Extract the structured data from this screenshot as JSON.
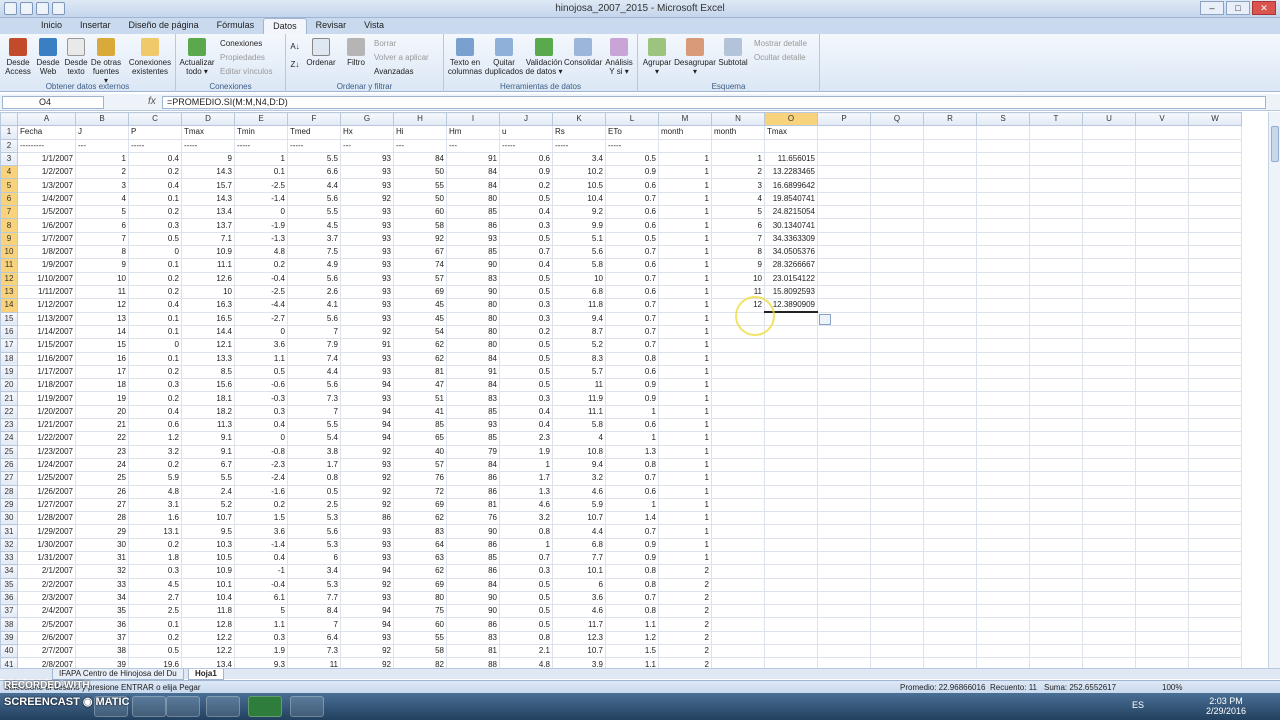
{
  "window": {
    "title": "hinojosa_2007_2015 - Microsoft Excel"
  },
  "tabs": [
    "Inicio",
    "Insertar",
    "Diseño de página",
    "Fórmulas",
    "Datos",
    "Revisar",
    "Vista"
  ],
  "active_tab": "Datos",
  "ribbon": {
    "groups": [
      {
        "label": "Obtener datos externos",
        "buttons": [
          "Desde Access",
          "Desde Web",
          "Desde texto",
          "De otras fuentes ▾",
          "Conexiones existentes"
        ]
      },
      {
        "label": "Conexiones",
        "buttons": [
          "Actualizar todo ▾"
        ],
        "small": [
          "Conexiones",
          "Propiedades",
          "Editar vínculos"
        ]
      },
      {
        "label": "Ordenar y filtrar",
        "buttons": [
          "Ordenar",
          "Filtro"
        ],
        "small": [
          "Borrar",
          "Volver a aplicar",
          "Avanzadas"
        ]
      },
      {
        "label": "Herramientas de datos",
        "buttons": [
          "Texto en columnas",
          "Quitar duplicados",
          "Validación de datos ▾",
          "Consolidar",
          "Análisis Y si ▾"
        ]
      },
      {
        "label": "Esquema",
        "buttons": [
          "Agrupar ▾",
          "Desagrupar ▾",
          "Subtotal"
        ],
        "small": [
          "Mostrar detalle",
          "Ocultar detalle"
        ]
      }
    ]
  },
  "formula_bar": {
    "name_box": "O4",
    "fx": "fx",
    "formula": "=PROMEDIO.SI(M:M,N4,D:D)"
  },
  "columns": [
    "A",
    "B",
    "C",
    "D",
    "E",
    "F",
    "G",
    "H",
    "I",
    "J",
    "K",
    "L",
    "M",
    "N",
    "O",
    "P",
    "Q",
    "R",
    "S",
    "T",
    "U",
    "V",
    "W"
  ],
  "selected_column": "O",
  "selected_rows": [
    4,
    5,
    6,
    7,
    8,
    9,
    10,
    11,
    12,
    13,
    14
  ],
  "rows": [
    {
      "n": "1",
      "c": [
        "Fecha",
        "J",
        "P",
        "Tmax",
        "Tmin",
        "Tmed",
        "Hx",
        "Hi",
        "Hm",
        "u",
        "Rs",
        "ETo",
        "month",
        "month",
        "Tmax"
      ]
    },
    {
      "n": "2",
      "c": [
        "---------",
        "---",
        "-----",
        "-----",
        "-----",
        "-----",
        "---",
        "---",
        "---",
        "-----",
        "-----",
        "-----",
        "",
        "",
        ""
      ]
    },
    {
      "n": "3",
      "c": [
        "1/1/2007",
        "1",
        "0.4",
        "9",
        "1",
        "5.5",
        "93",
        "84",
        "91",
        "0.6",
        "3.4",
        "0.5",
        "1",
        "1",
        "11.656015"
      ]
    },
    {
      "n": "4",
      "c": [
        "1/2/2007",
        "2",
        "0.2",
        "14.3",
        "0.1",
        "6.6",
        "93",
        "50",
        "84",
        "0.9",
        "10.2",
        "0.9",
        "1",
        "2",
        "13.2283465"
      ]
    },
    {
      "n": "5",
      "c": [
        "1/3/2007",
        "3",
        "0.4",
        "15.7",
        "-2.5",
        "4.4",
        "93",
        "55",
        "84",
        "0.2",
        "10.5",
        "0.6",
        "1",
        "3",
        "16.6899642"
      ]
    },
    {
      "n": "6",
      "c": [
        "1/4/2007",
        "4",
        "0.1",
        "14.3",
        "-1.4",
        "5.6",
        "92",
        "50",
        "80",
        "0.5",
        "10.4",
        "0.7",
        "1",
        "4",
        "19.8540741"
      ]
    },
    {
      "n": "7",
      "c": [
        "1/5/2007",
        "5",
        "0.2",
        "13.4",
        "0",
        "5.5",
        "93",
        "60",
        "85",
        "0.4",
        "9.2",
        "0.6",
        "1",
        "5",
        "24.8215054"
      ]
    },
    {
      "n": "8",
      "c": [
        "1/6/2007",
        "6",
        "0.3",
        "13.7",
        "-1.9",
        "4.5",
        "93",
        "58",
        "86",
        "0.3",
        "9.9",
        "0.6",
        "1",
        "6",
        "30.1340741"
      ]
    },
    {
      "n": "9",
      "c": [
        "1/7/2007",
        "7",
        "0.5",
        "7.1",
        "-1.3",
        "3.7",
        "93",
        "92",
        "93",
        "0.5",
        "5.1",
        "0.5",
        "1",
        "7",
        "34.3363309"
      ]
    },
    {
      "n": "10",
      "c": [
        "1/8/2007",
        "8",
        "0",
        "10.9",
        "4.8",
        "7.5",
        "93",
        "67",
        "85",
        "0.7",
        "5.6",
        "0.7",
        "1",
        "8",
        "34.0505376"
      ]
    },
    {
      "n": "11",
      "c": [
        "1/9/2007",
        "9",
        "0.1",
        "11.1",
        "0.2",
        "4.9",
        "93",
        "74",
        "90",
        "0.4",
        "5.8",
        "0.6",
        "1",
        "9",
        "28.3266667"
      ]
    },
    {
      "n": "12",
      "c": [
        "1/10/2007",
        "10",
        "0.2",
        "12.6",
        "-0.4",
        "5.6",
        "93",
        "57",
        "83",
        "0.5",
        "10",
        "0.7",
        "1",
        "10",
        "23.0154122"
      ]
    },
    {
      "n": "13",
      "c": [
        "1/11/2007",
        "11",
        "0.2",
        "10",
        "-2.5",
        "2.6",
        "93",
        "69",
        "90",
        "0.5",
        "6.8",
        "0.6",
        "1",
        "11",
        "15.8092593"
      ]
    },
    {
      "n": "14",
      "c": [
        "1/12/2007",
        "12",
        "0.4",
        "16.3",
        "-4.4",
        "4.1",
        "93",
        "45",
        "80",
        "0.3",
        "11.8",
        "0.7",
        "1",
        "12",
        "12.3890909"
      ]
    },
    {
      "n": "15",
      "c": [
        "1/13/2007",
        "13",
        "0.1",
        "16.5",
        "-2.7",
        "5.6",
        "93",
        "45",
        "80",
        "0.3",
        "9.4",
        "0.7",
        "1",
        "",
        ""
      ]
    },
    {
      "n": "16",
      "c": [
        "1/14/2007",
        "14",
        "0.1",
        "14.4",
        "0",
        "7",
        "92",
        "54",
        "80",
        "0.2",
        "8.7",
        "0.7",
        "1",
        "",
        ""
      ]
    },
    {
      "n": "17",
      "c": [
        "1/15/2007",
        "15",
        "0",
        "12.1",
        "3.6",
        "7.9",
        "91",
        "62",
        "80",
        "0.5",
        "5.2",
        "0.7",
        "1",
        "",
        ""
      ]
    },
    {
      "n": "18",
      "c": [
        "1/16/2007",
        "16",
        "0.1",
        "13.3",
        "1.1",
        "7.4",
        "93",
        "62",
        "84",
        "0.5",
        "8.3",
        "0.8",
        "1",
        "",
        ""
      ]
    },
    {
      "n": "19",
      "c": [
        "1/17/2007",
        "17",
        "0.2",
        "8.5",
        "0.5",
        "4.4",
        "93",
        "81",
        "91",
        "0.5",
        "5.7",
        "0.6",
        "1",
        "",
        ""
      ]
    },
    {
      "n": "20",
      "c": [
        "1/18/2007",
        "18",
        "0.3",
        "15.6",
        "-0.6",
        "5.6",
        "94",
        "47",
        "84",
        "0.5",
        "11",
        "0.9",
        "1",
        "",
        ""
      ]
    },
    {
      "n": "21",
      "c": [
        "1/19/2007",
        "19",
        "0.2",
        "18.1",
        "-0.3",
        "7.3",
        "93",
        "51",
        "83",
        "0.3",
        "11.9",
        "0.9",
        "1",
        "",
        ""
      ]
    },
    {
      "n": "22",
      "c": [
        "1/20/2007",
        "20",
        "0.4",
        "18.2",
        "0.3",
        "7",
        "94",
        "41",
        "85",
        "0.4",
        "11.1",
        "1",
        "1",
        "",
        ""
      ]
    },
    {
      "n": "23",
      "c": [
        "1/21/2007",
        "21",
        "0.6",
        "11.3",
        "0.4",
        "5.5",
        "94",
        "85",
        "93",
        "0.4",
        "5.8",
        "0.6",
        "1",
        "",
        ""
      ]
    },
    {
      "n": "24",
      "c": [
        "1/22/2007",
        "22",
        "1.2",
        "9.1",
        "0",
        "5.4",
        "94",
        "65",
        "85",
        "2.3",
        "4",
        "1",
        "1",
        "",
        ""
      ]
    },
    {
      "n": "25",
      "c": [
        "1/23/2007",
        "23",
        "3.2",
        "9.1",
        "-0.8",
        "3.8",
        "92",
        "40",
        "79",
        "1.9",
        "10.8",
        "1.3",
        "1",
        "",
        ""
      ]
    },
    {
      "n": "26",
      "c": [
        "1/24/2007",
        "24",
        "0.2",
        "6.7",
        "-2.3",
        "1.7",
        "93",
        "57",
        "84",
        "1",
        "9.4",
        "0.8",
        "1",
        "",
        ""
      ]
    },
    {
      "n": "27",
      "c": [
        "1/25/2007",
        "25",
        "5.9",
        "5.5",
        "-2.4",
        "0.8",
        "92",
        "76",
        "86",
        "1.7",
        "3.2",
        "0.7",
        "1",
        "",
        ""
      ]
    },
    {
      "n": "28",
      "c": [
        "1/26/2007",
        "26",
        "4.8",
        "2.4",
        "-1.6",
        "0.5",
        "92",
        "72",
        "86",
        "1.3",
        "4.6",
        "0.6",
        "1",
        "",
        ""
      ]
    },
    {
      "n": "29",
      "c": [
        "1/27/2007",
        "27",
        "3.1",
        "5.2",
        "0.2",
        "2.5",
        "92",
        "69",
        "81",
        "4.6",
        "5.9",
        "1",
        "1",
        "",
        ""
      ]
    },
    {
      "n": "30",
      "c": [
        "1/28/2007",
        "28",
        "1.6",
        "10.7",
        "1.5",
        "5.3",
        "86",
        "62",
        "76",
        "3.2",
        "10.7",
        "1.4",
        "1",
        "",
        ""
      ]
    },
    {
      "n": "31",
      "c": [
        "1/29/2007",
        "29",
        "13.1",
        "9.5",
        "3.6",
        "5.6",
        "93",
        "83",
        "90",
        "0.8",
        "4.4",
        "0.7",
        "1",
        "",
        ""
      ]
    },
    {
      "n": "32",
      "c": [
        "1/30/2007",
        "30",
        "0.2",
        "10.3",
        "-1.4",
        "5.3",
        "93",
        "64",
        "86",
        "1",
        "6.8",
        "0.9",
        "1",
        "",
        ""
      ]
    },
    {
      "n": "33",
      "c": [
        "1/31/2007",
        "31",
        "1.8",
        "10.5",
        "0.4",
        "6",
        "93",
        "63",
        "85",
        "0.7",
        "7.7",
        "0.9",
        "1",
        "",
        ""
      ]
    },
    {
      "n": "34",
      "c": [
        "2/1/2007",
        "32",
        "0.3",
        "10.9",
        "-1",
        "3.4",
        "94",
        "62",
        "86",
        "0.3",
        "10.1",
        "0.8",
        "2",
        "",
        ""
      ]
    },
    {
      "n": "35",
      "c": [
        "2/2/2007",
        "33",
        "4.5",
        "10.1",
        "-0.4",
        "5.3",
        "92",
        "69",
        "84",
        "0.5",
        "6",
        "0.8",
        "2",
        "",
        ""
      ]
    },
    {
      "n": "36",
      "c": [
        "2/3/2007",
        "34",
        "2.7",
        "10.4",
        "6.1",
        "7.7",
        "93",
        "80",
        "90",
        "0.5",
        "3.6",
        "0.7",
        "2",
        "",
        ""
      ]
    },
    {
      "n": "37",
      "c": [
        "2/4/2007",
        "35",
        "2.5",
        "11.8",
        "5",
        "8.4",
        "94",
        "75",
        "90",
        "0.5",
        "4.6",
        "0.8",
        "2",
        "",
        ""
      ]
    },
    {
      "n": "38",
      "c": [
        "2/5/2007",
        "36",
        "0.1",
        "12.8",
        "1.1",
        "7",
        "94",
        "60",
        "86",
        "0.5",
        "11.7",
        "1.1",
        "2",
        "",
        ""
      ]
    },
    {
      "n": "39",
      "c": [
        "2/6/2007",
        "37",
        "0.2",
        "12.2",
        "0.3",
        "6.4",
        "93",
        "55",
        "83",
        "0.8",
        "12.3",
        "1.2",
        "2",
        "",
        ""
      ]
    },
    {
      "n": "40",
      "c": [
        "2/7/2007",
        "38",
        "0.5",
        "12.2",
        "1.9",
        "7.3",
        "92",
        "58",
        "81",
        "2.1",
        "10.7",
        "1.5",
        "2",
        "",
        ""
      ]
    },
    {
      "n": "41",
      "c": [
        "2/8/2007",
        "39",
        "19.6",
        "13.4",
        "9.3",
        "11",
        "92",
        "82",
        "88",
        "4.8",
        "3.9",
        "1.1",
        "2",
        "",
        ""
      ]
    }
  ],
  "sheet_tabs": [
    "IFAPA Centro de Hinojosa del Du",
    "Hoja1"
  ],
  "active_sheet": "Hoja1",
  "status": {
    "message": "Seleccione el destino y presione ENTRAR o elija Pegar",
    "average": "Promedio: 22.96866016",
    "count": "Recuento: 11",
    "sum": "Suma: 252.6552617",
    "zoom": "100%"
  },
  "watermark": {
    "line1": "RECORDED WITH",
    "line2": "SCREENCAST ◉ MATIC"
  },
  "taskbar": {
    "lang": "ES",
    "time": "2:03 PM",
    "date": "2/29/2016"
  },
  "colors": {
    "accent": "#f8d37c",
    "ribbon": "#dbe7f5",
    "taskbar": "#22405f"
  }
}
